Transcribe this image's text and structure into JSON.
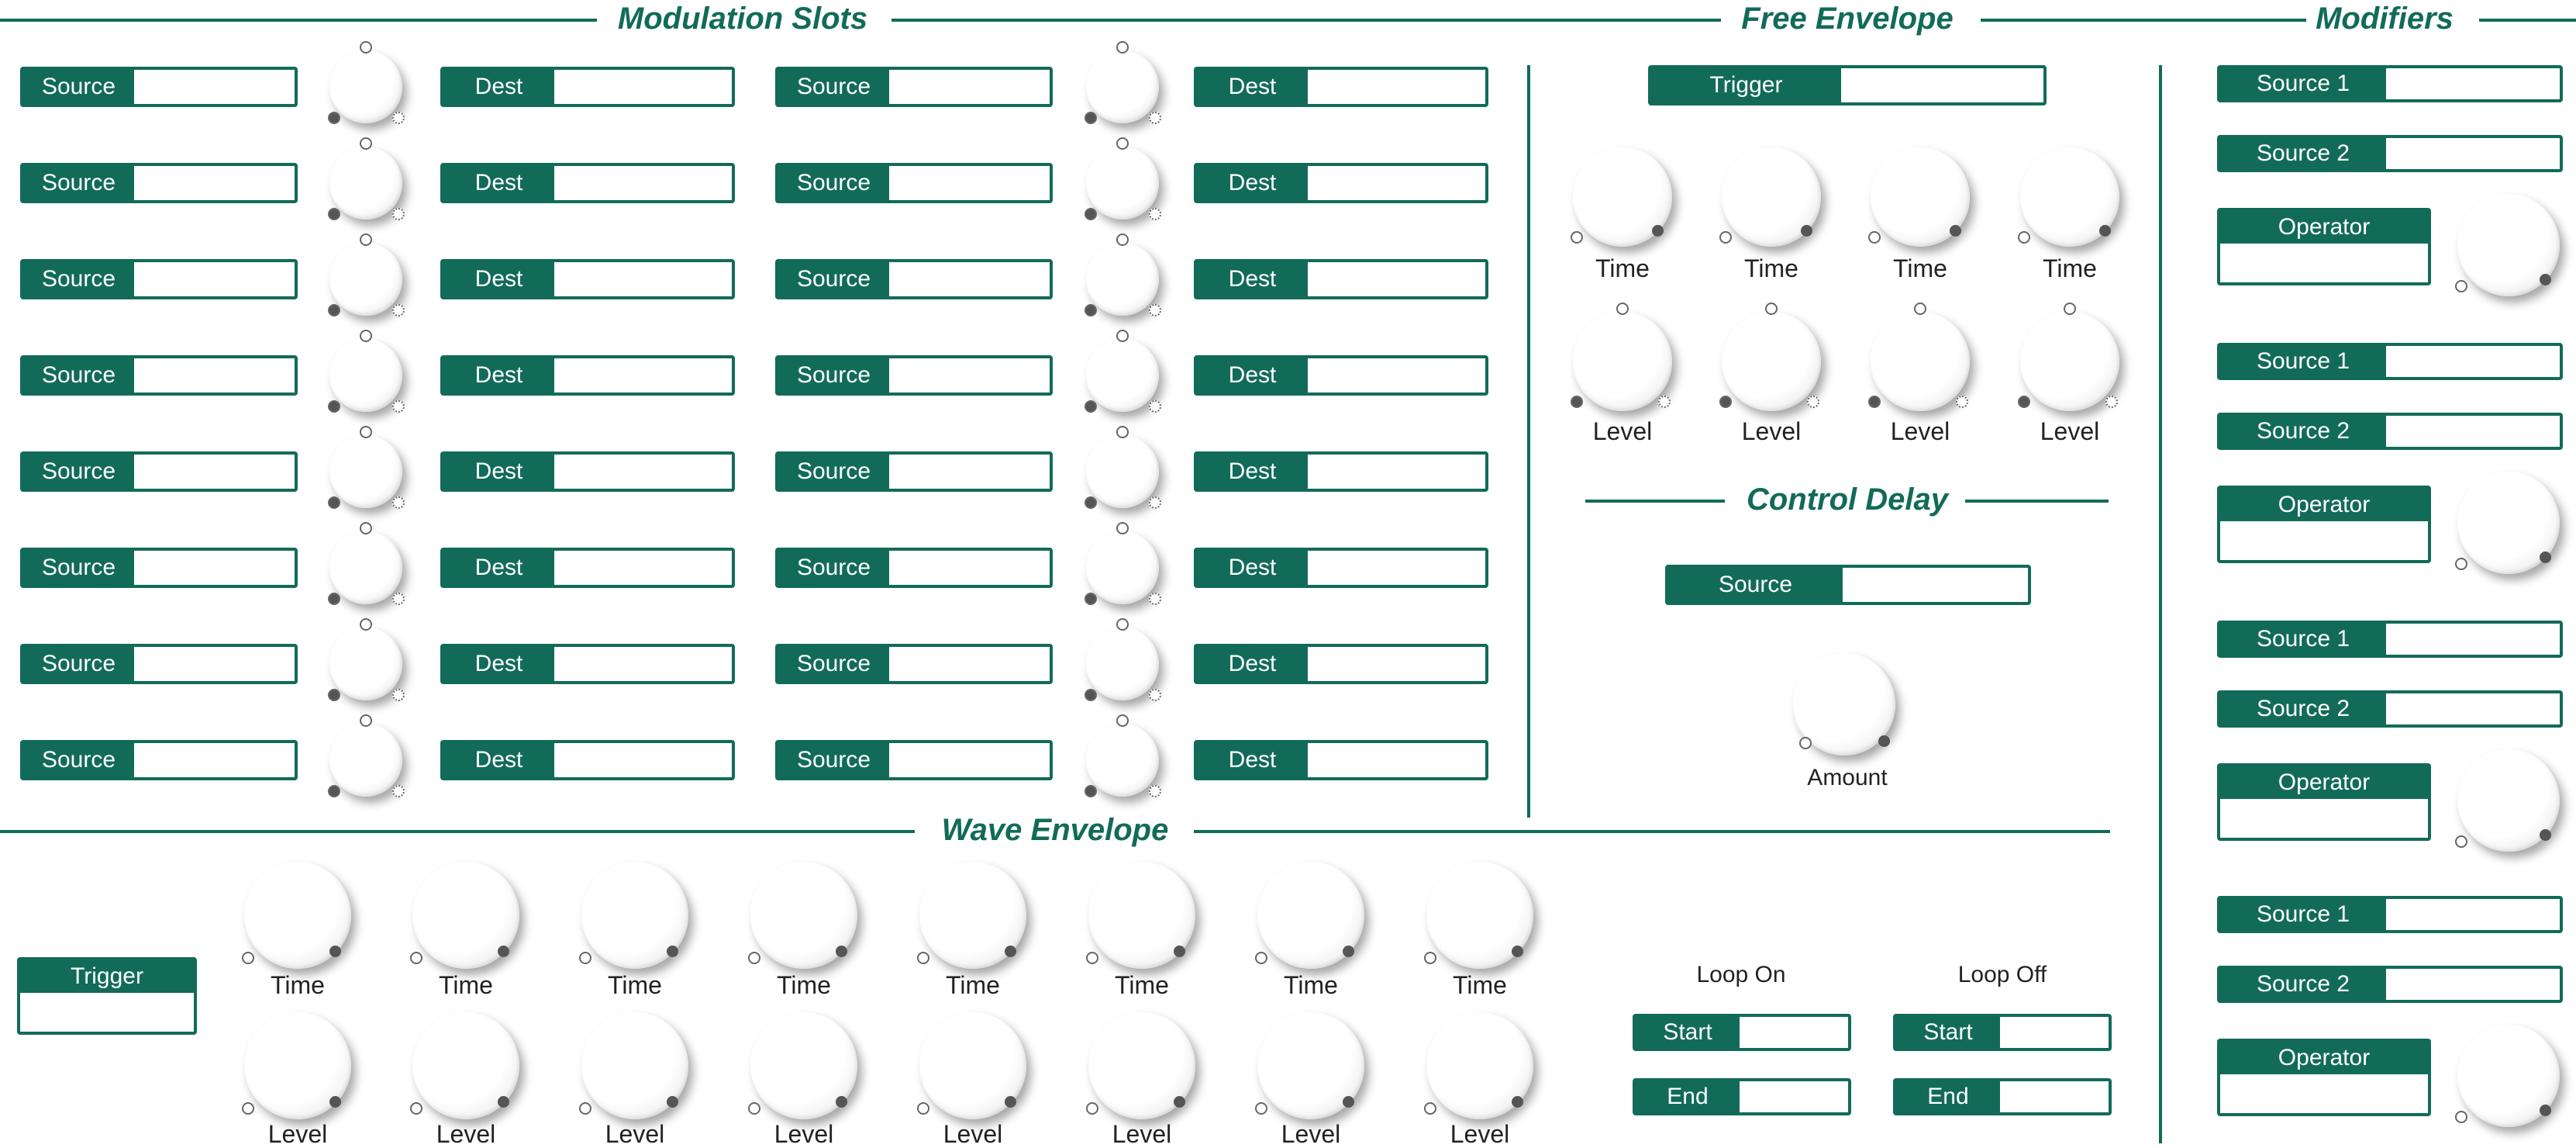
{
  "sections": {
    "modulation_slots": "Modulation Slots",
    "free_envelope": "Free Envelope",
    "modifiers": "Modifiers",
    "control_delay": "Control Delay",
    "wave_envelope": "Wave Envelope"
  },
  "modulation": {
    "source_label": "Source",
    "dest_label": "Dest"
  },
  "free_envelope": {
    "trigger_label": "Trigger",
    "time_label": "Time",
    "level_label": "Level"
  },
  "control_delay": {
    "source_label": "Source",
    "amount_label": "Amount"
  },
  "modifiers": {
    "source1_label": "Source 1",
    "source2_label": "Source 2",
    "operator_label": "Operator"
  },
  "wave_envelope": {
    "trigger_label": "Trigger",
    "time_label": "Time",
    "level_label": "Level",
    "loop_on_label": "Loop On",
    "loop_off_label": "Loop Off",
    "start_label": "Start",
    "end_label": "End"
  },
  "colors": {
    "accent": "#126b59"
  },
  "icons": {
    "knob": "rotary-knob-icon",
    "bipolar_knob": "bipolar-knob-icon"
  }
}
